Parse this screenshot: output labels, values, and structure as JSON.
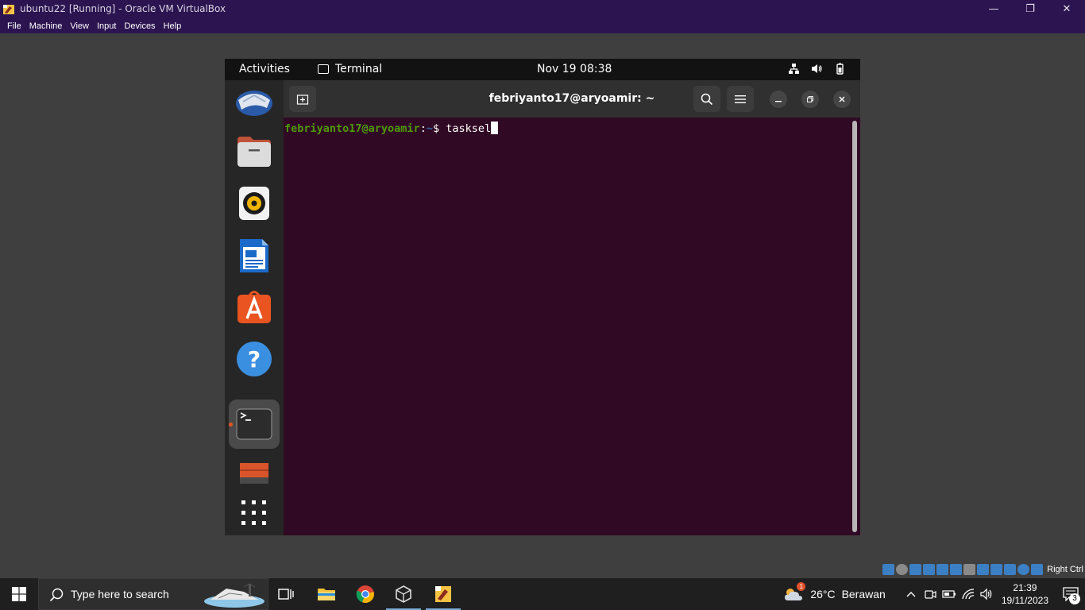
{
  "host": {
    "title": "ubuntu22 [Running] - Oracle VM VirtualBox",
    "menu": [
      "File",
      "Machine",
      "View",
      "Input",
      "Devices",
      "Help"
    ],
    "window_controls": {
      "minimize": "—",
      "restore": "❐",
      "close": "✕"
    },
    "host_key_label": "Right Ctrl"
  },
  "ubuntu": {
    "topbar": {
      "activities": "Activities",
      "app_name": "Terminal",
      "datetime": "Nov 19  08:38"
    },
    "dock": [
      "thunderbird-icon",
      "files-icon",
      "rhythmbox-icon",
      "writer-icon",
      "app-center-icon",
      "help-icon",
      "terminal-icon",
      "usb-drive-icon",
      "show-apps-icon"
    ],
    "terminal": {
      "title": "febriyanto17@aryoamir: ~",
      "prompt_user": "febriyanto17@aryoamir",
      "prompt_sep": ":",
      "prompt_path": "~",
      "prompt_symbol": "$ ",
      "command": "tasksel"
    }
  },
  "taskbar": {
    "search_placeholder": "Type here to search",
    "weather": {
      "temp": "26°C",
      "condition": "Berawan",
      "badge": "1"
    },
    "time": "21:39",
    "date": "19/11/2023",
    "notification_count": "3"
  },
  "colors": {
    "host_titlebar": "#2c1450",
    "terminal_bg": "#300a24",
    "prompt_green": "#4e9a06",
    "prompt_blue": "#3465a4",
    "ubuntu_orange": "#e95420"
  }
}
